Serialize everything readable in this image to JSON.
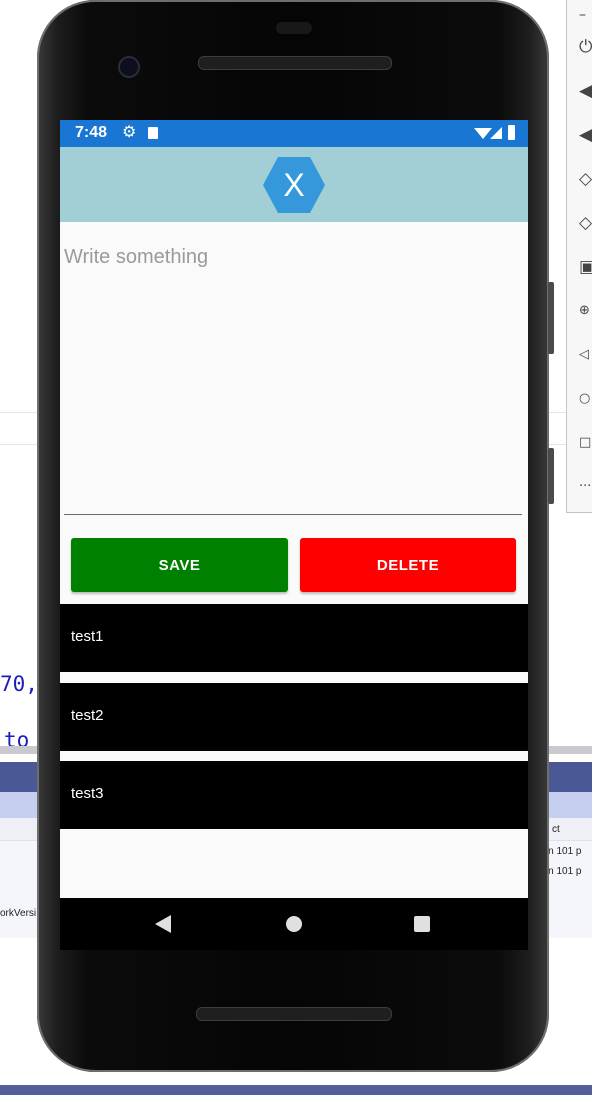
{
  "ide": {
    "code_fragment_1": "70,",
    "code_fragment_2": "to",
    "panel_text_right_1": "ct",
    "panel_text_right_2": "arin 101 p",
    "panel_text_right_3": "arin 101 p",
    "panel_text_left": "orkVersi"
  },
  "emulator_toolbar": {
    "tools": [
      "minimize-icon",
      "power-icon",
      "volume-up-icon",
      "volume-down-icon",
      "rotate-left-icon",
      "rotate-right-icon",
      "camera-icon",
      "zoom-icon",
      "back-icon",
      "home-icon",
      "overview-icon",
      "more-icon"
    ],
    "minimize_glyph": "–"
  },
  "status_bar": {
    "time": "7:48",
    "color": "#1976d2"
  },
  "header": {
    "color": "#a2ced6",
    "logo_icon": "xamarin-logo-icon",
    "logo_letter": "X"
  },
  "editor": {
    "placeholder": "Write something",
    "value": ""
  },
  "buttons": {
    "save_label": "SAVE",
    "save_color": "#008000",
    "delete_label": "DELETE",
    "delete_color": "#ff0000"
  },
  "notes": [
    {
      "text": "test1"
    },
    {
      "text": "test2"
    },
    {
      "text": "test3"
    }
  ],
  "nav_bar": {
    "items": [
      "back-icon",
      "home-icon",
      "recents-icon"
    ]
  }
}
